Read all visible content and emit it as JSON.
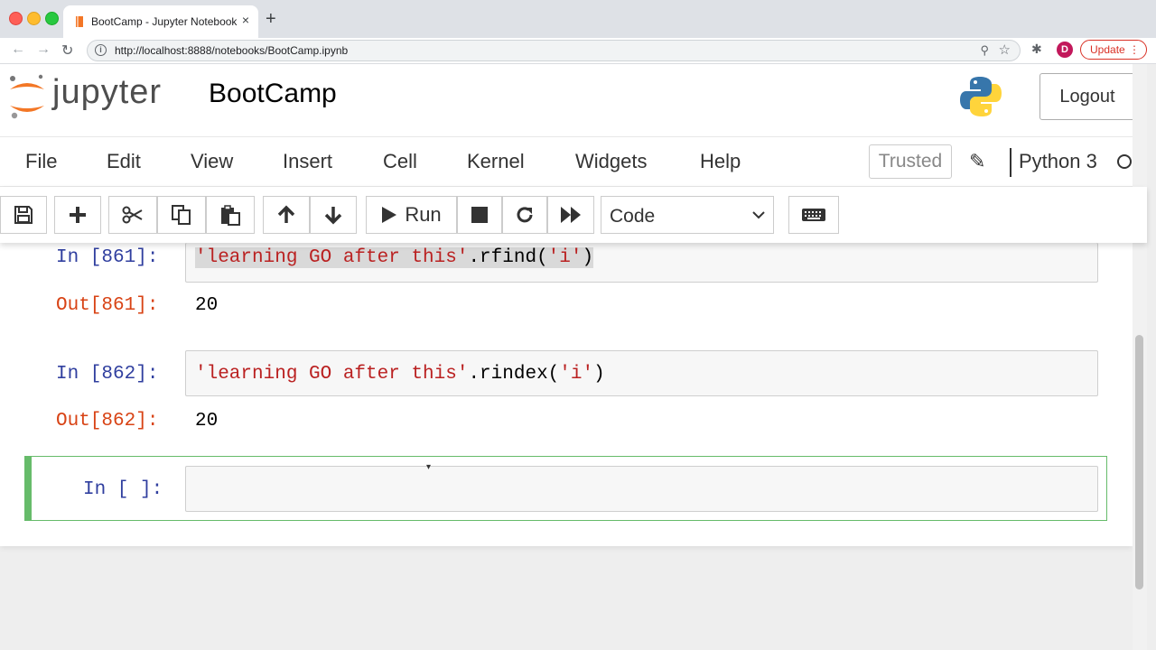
{
  "browser": {
    "tab_title": "BootCamp - Jupyter Notebook",
    "tab_close": "×",
    "new_tab": "+",
    "url": "http://localhost:8888/notebooks/BootCamp.ipynb",
    "profile_initial": "D",
    "update_label": "Update",
    "update_dots": "⋮",
    "info_glyph": "i",
    "zoom_glyph": "⚲",
    "star_glyph": "☆",
    "ext_glyph": "✱"
  },
  "header": {
    "logo_text": "jupyter",
    "notebook_name": "BootCamp",
    "logout_label": "Logout"
  },
  "menubar": {
    "items": [
      "File",
      "Edit",
      "View",
      "Insert",
      "Cell",
      "Kernel",
      "Widgets",
      "Help"
    ],
    "trusted_label": "Trusted",
    "kernel_name": "Python 3"
  },
  "toolbar": {
    "run_label": "Run",
    "cell_type": "Code"
  },
  "cells": [
    {
      "in_prompt": "In [861]:",
      "code_str": "'learning GO after this'",
      "code_call": ".rfind(",
      "code_arg": "'i'",
      "code_close": ")",
      "out_prompt": "Out[861]:",
      "output": "20"
    },
    {
      "in_prompt": "In [862]:",
      "code_str": "'learning GO after this'",
      "code_call": ".rindex(",
      "code_arg": "'i'",
      "code_close": ")",
      "out_prompt": "Out[862]:",
      "output": "20"
    },
    {
      "in_prompt": "In [ ]:",
      "code": ""
    }
  ],
  "colors": {
    "selected_cell_border": "#66bb6a",
    "in_prompt": "#303f9f",
    "out_prompt": "#d84315",
    "string": "#ba2121"
  }
}
